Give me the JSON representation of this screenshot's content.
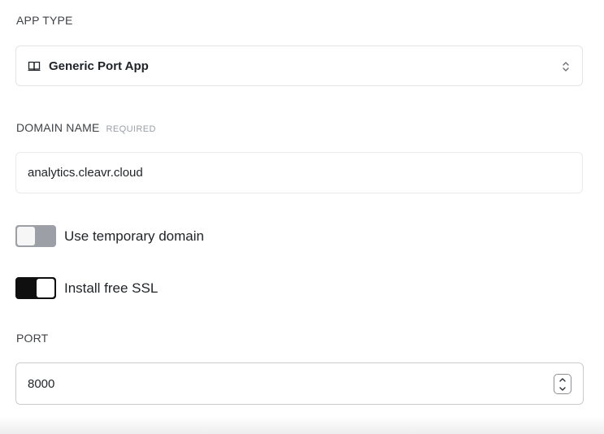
{
  "app_type": {
    "label": "APP TYPE",
    "selected_value": "Generic Port App",
    "icon": "book-icon"
  },
  "domain_name": {
    "label": "DOMAIN NAME",
    "required_tag": "REQUIRED",
    "value": "analytics.cleavr.cloud"
  },
  "temporary_domain": {
    "label": "Use temporary domain",
    "enabled": false
  },
  "free_ssl": {
    "label": "Install free SSL",
    "enabled": true
  },
  "port": {
    "label": "PORT",
    "value": "8000"
  },
  "colors": {
    "toggle_on": "#0f0f10",
    "toggle_off": "#9ca0a6",
    "label_text": "#3f4247",
    "required_text": "#9aa0a6"
  }
}
